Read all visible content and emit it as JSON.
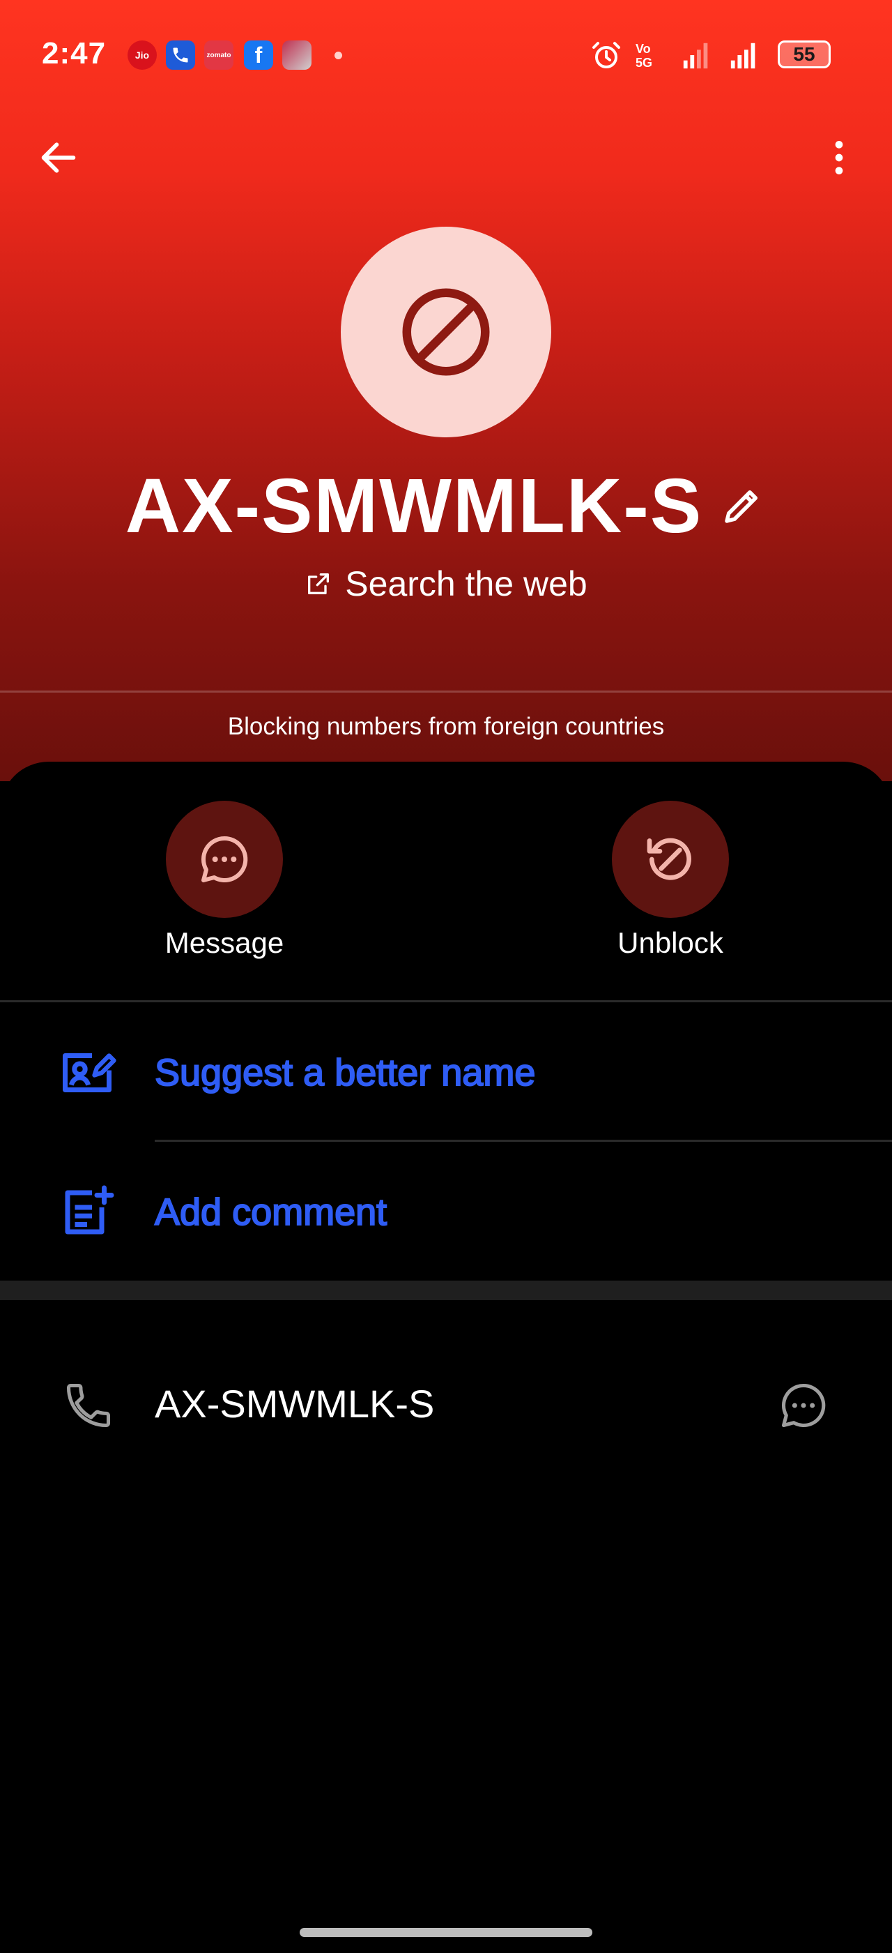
{
  "status_bar": {
    "time": "2:47",
    "notification_apps": [
      "jio-icon",
      "phone-app-icon",
      "zomato-icon",
      "facebook-icon",
      "gallery-icon"
    ],
    "jio_label": "Jio",
    "zomato_label": "zomato",
    "network_label": "Vo 5G",
    "battery": "55"
  },
  "toolbar": {
    "back_icon": "arrow-left-icon",
    "more_icon": "more-vertical-icon"
  },
  "contact": {
    "avatar_icon": "block-icon",
    "name": "AX-SMWMLK-S",
    "search_web": "Search the web",
    "block_note": "Blocking numbers from foreign countries"
  },
  "actions": [
    {
      "label": "Message",
      "icon": "chat-bubble-icon"
    },
    {
      "label": "Unblock",
      "icon": "unblock-icon"
    }
  ],
  "list": [
    {
      "label": "Suggest a better name",
      "icon": "edit-contact-icon"
    },
    {
      "label": "Add comment",
      "icon": "add-note-icon"
    }
  ],
  "phone": {
    "number": "AX-SMWMLK-S",
    "icon": "phone-icon",
    "message_icon": "chat-bubble-icon"
  },
  "colors": {
    "hero_top": "#ff3420",
    "hero_bottom": "#6a100c",
    "accent_blue": "#2f5df5",
    "action_bg": "#5e1410"
  }
}
